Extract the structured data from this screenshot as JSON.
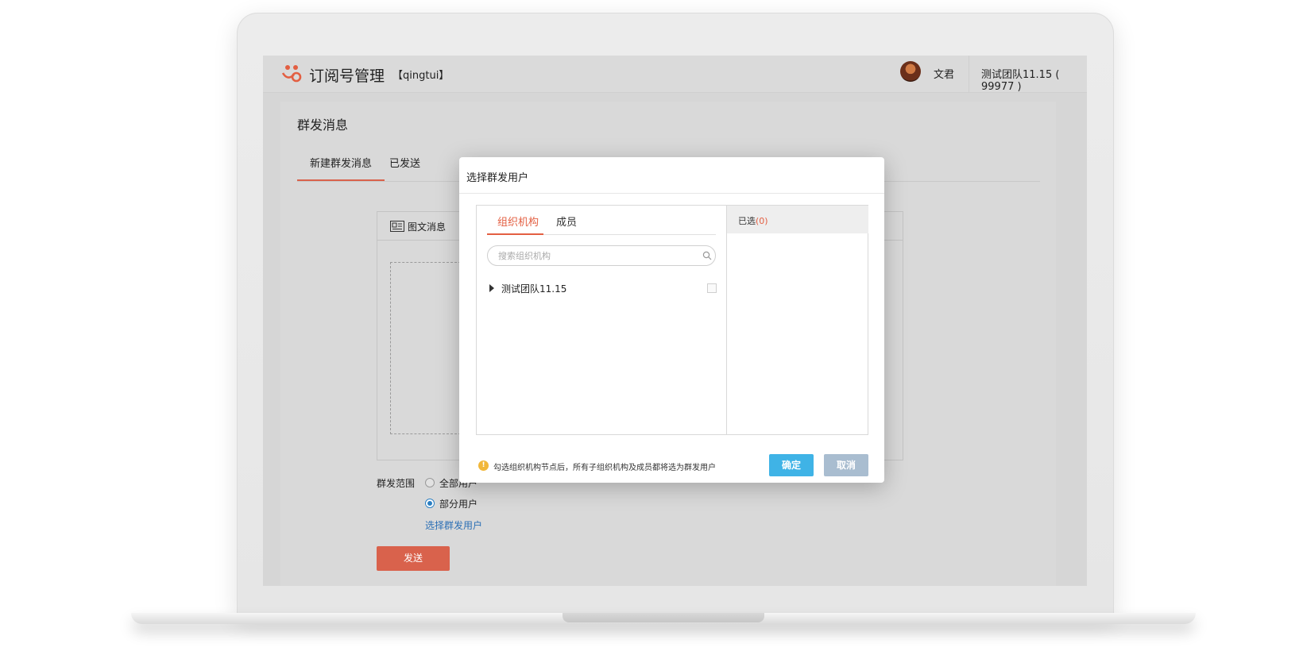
{
  "app": {
    "title": "订阅号管理",
    "account_tag": "【qingtui】",
    "user_name": "文君",
    "team_label": "测试团队11.15 ( 99977 )"
  },
  "page": {
    "title": "群发消息",
    "tabs": [
      {
        "label": "新建群发消息",
        "active": true
      },
      {
        "label": "已发送",
        "active": false
      }
    ],
    "editor_tab_label": "图文消息",
    "range_label": "群发范围",
    "radio_all_label": "全部用户",
    "radio_partial_label": "部分用户",
    "radio_selected": "部分用户",
    "select_users_link": "选择群发用户",
    "send_button": "发送"
  },
  "modal": {
    "title": "选择群发用户",
    "tabs": [
      {
        "label": "组织机构",
        "active": true
      },
      {
        "label": "成员",
        "active": false
      }
    ],
    "search_placeholder": "搜索组织机构",
    "search_value": "",
    "tree": [
      {
        "label": "测试团队11.15",
        "checked": false,
        "expanded": false
      }
    ],
    "selected_label": "已选",
    "selected_count": "(0)",
    "hint": "勾选组织机构节点后，所有子组织机构及成员都将选为群发用户",
    "ok_button": "确定",
    "cancel_button": "取消"
  },
  "colors": {
    "brand": "#e35f42",
    "primary_button": "#3fb3e6",
    "cancel_button": "#a9bdd0",
    "link": "#2b6fb5",
    "warning": "#f1b73a"
  }
}
